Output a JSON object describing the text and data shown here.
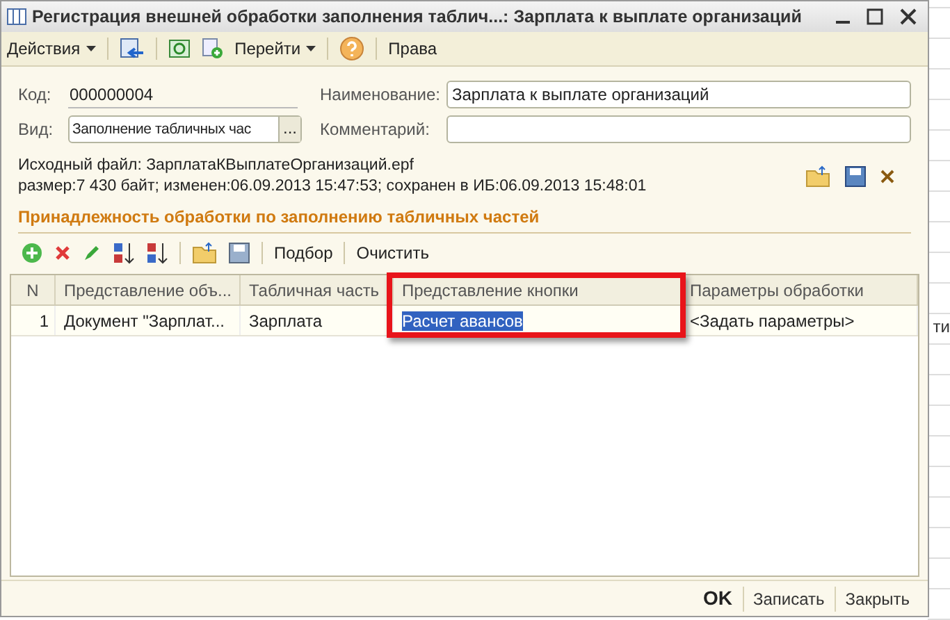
{
  "window": {
    "title": "Регистрация внешней обработки заполнения таблич...: Зарплата к выплате организаций"
  },
  "toolbar": {
    "actions": "Действия",
    "goto": "Перейти",
    "rights": "Права"
  },
  "form": {
    "code_label": "Код:",
    "code": "000000004",
    "name_label": "Наименование:",
    "name": "Зарплата к выплате организаций",
    "kind_label": "Вид:",
    "kind": "Заполнение табличных час",
    "kind_button": "...",
    "comment_label": "Комментарий:",
    "file_line": "Исходный файл: ЗарплатаКВыплатеОрганизаций.epf",
    "info_line": "размер:7 430 байт; изменен:06.09.2013 15:47:53; сохранен в ИБ:06.09.2013 15:48:01"
  },
  "section": {
    "title": "Принадлежность обработки по заполнению табличных частей",
    "pick": "Подбор",
    "clear": "Очистить"
  },
  "table": {
    "columns": [
      {
        "label": "N",
        "highlighted": false
      },
      {
        "label": "Представление объ...",
        "highlighted": false
      },
      {
        "label": "Табличная часть",
        "highlighted": false
      },
      {
        "label": "Представление кнопки",
        "highlighted": true
      },
      {
        "label": "Параметры обработки",
        "highlighted": false
      }
    ],
    "rows": [
      {
        "cells": [
          "1",
          "Документ \"Зарплат...",
          "Зарплата",
          "Расчет авансов",
          "<Задать параметры>"
        ],
        "selected": true
      }
    ]
  },
  "buttons": [
    "OK",
    "Записать",
    "Закрыть"
  ],
  "background_text": "ти"
}
